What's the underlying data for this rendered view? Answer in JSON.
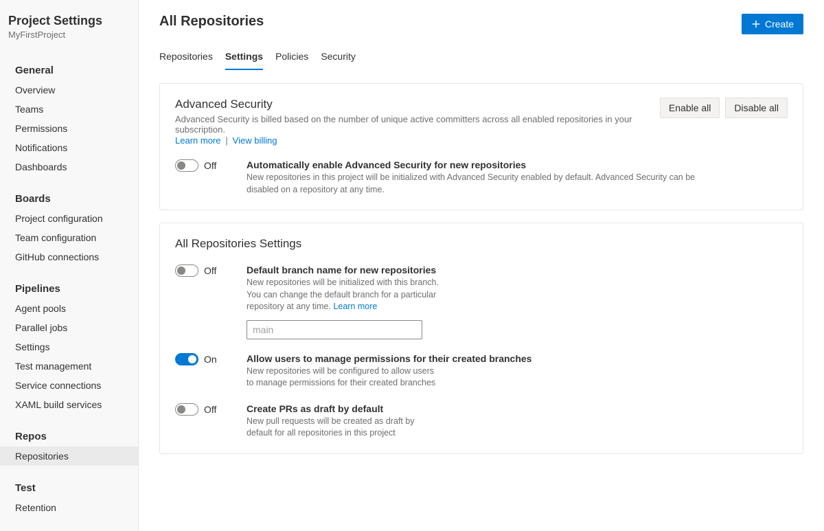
{
  "sidebar": {
    "title": "Project Settings",
    "subtitle": "MyFirstProject",
    "groups": [
      {
        "label": "General",
        "items": [
          "Overview",
          "Teams",
          "Permissions",
          "Notifications",
          "Dashboards"
        ]
      },
      {
        "label": "Boards",
        "items": [
          "Project configuration",
          "Team configuration",
          "GitHub connections"
        ]
      },
      {
        "label": "Pipelines",
        "items": [
          "Agent pools",
          "Parallel jobs",
          "Settings",
          "Test management",
          "Service connections",
          "XAML build services"
        ]
      },
      {
        "label": "Repos",
        "items": [
          "Repositories"
        ]
      },
      {
        "label": "Test",
        "items": [
          "Retention"
        ]
      }
    ],
    "activeItem": "Repositories"
  },
  "page": {
    "title": "All Repositories",
    "create_label": "Create"
  },
  "tabs": {
    "items": [
      "Repositories",
      "Settings",
      "Policies",
      "Security"
    ],
    "active": "Settings"
  },
  "advanced_security": {
    "title": "Advanced Security",
    "desc": "Advanced Security is billed based on the number of unique active committers across all enabled repositories in your subscription.",
    "learn_more": "Learn more",
    "view_billing": "View billing",
    "enable_all": "Enable all",
    "disable_all": "Disable all",
    "auto_enable": {
      "state": "Off",
      "on": false,
      "title": "Automatically enable Advanced Security for new repositories",
      "desc": "New repositories in this project will be initialized with Advanced Security enabled by default. Advanced Security can be disabled on a repository at any time."
    }
  },
  "all_repo_settings": {
    "title": "All Repositories Settings",
    "default_branch": {
      "state": "Off",
      "on": false,
      "title": "Default branch name for new repositories",
      "desc": "New repositories will be initialized with this branch. You can change the default branch for a particular repository at any time. ",
      "learn_more": "Learn more",
      "placeholder": "main",
      "value": ""
    },
    "manage_permissions": {
      "state": "On",
      "on": true,
      "title": "Allow users to manage permissions for their created branches",
      "desc": "New repositories will be configured to allow users to manage permissions for their created branches"
    },
    "draft_pr": {
      "state": "Off",
      "on": false,
      "title": "Create PRs as draft by default",
      "desc": "New pull requests will be created as draft by default for all repositories in this project"
    }
  }
}
